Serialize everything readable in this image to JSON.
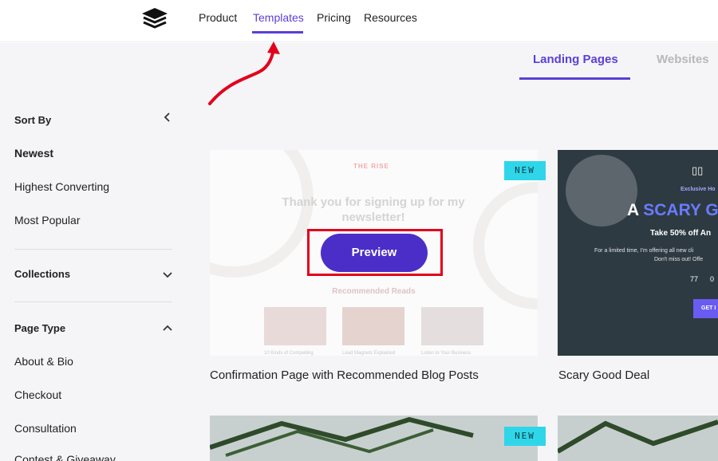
{
  "nav": {
    "logo_icon": "layers-icon",
    "links": [
      "Product",
      "Templates",
      "Pricing",
      "Resources"
    ],
    "active": "Templates"
  },
  "tabs": {
    "items": [
      "Landing Pages",
      "Websites"
    ],
    "active": "Landing Pages"
  },
  "sidebar": {
    "sort_by": "Sort By",
    "sort_options": [
      "Newest",
      "Highest Converting",
      "Most Popular"
    ],
    "selected_sort": "Newest",
    "collections": "Collections",
    "page_type": "Page Type",
    "page_types": [
      "About & Bio",
      "Checkout",
      "Consultation",
      "Contest & Giveaway"
    ]
  },
  "cards": [
    {
      "title": "Confirmation Page with Recommended Blog Posts",
      "badge": "NEW",
      "preview_label": "Preview",
      "brand": "THE RISE",
      "heading": "Thank you for signing up for my newsletter!",
      "section": "Recommended Reads",
      "thumbs": [
        "10 Kinds of Compelling",
        "Lead Magnets Explained",
        "Listen to Your Business"
      ]
    },
    {
      "title": "Scary Good Deal",
      "exclusive": "Exclusive Ho",
      "headline_a": "A ",
      "headline_b": "SCARY G",
      "offer": "Take 50% off An",
      "body_1": "For a limited time, I'm offering all new cli",
      "body_2": "Don't miss out! Offe",
      "count_1": "77",
      "count_2": "0",
      "cta": "GET I"
    },
    {
      "badge": "NEW"
    },
    {}
  ],
  "colors": {
    "accent": "#5b3fd6",
    "badge": "#2fd6ea",
    "highlight": "#e3001b"
  }
}
